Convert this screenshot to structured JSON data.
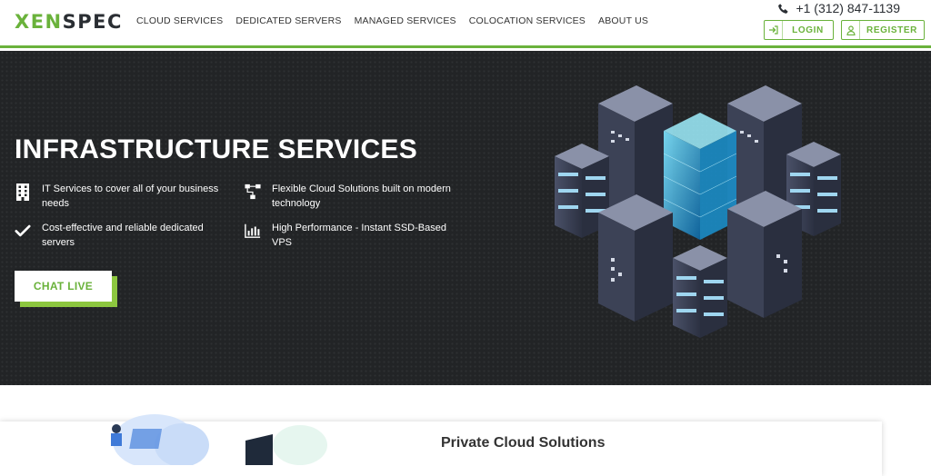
{
  "header": {
    "logo": {
      "part1": "XEN",
      "part2": "SPEC"
    },
    "nav": [
      "CLOUD SERVICES",
      "DEDICATED SERVERS",
      "MANAGED SERVICES",
      "COLOCATION SERVICES",
      "ABOUT US"
    ],
    "phone": "+1 (312) 847-1139",
    "login_label": "LOGIN",
    "register_label": "REGISTER"
  },
  "hero": {
    "title": "INFRASTRUCTURE SERVICES",
    "features": [
      {
        "icon": "building-icon",
        "text": "IT Services to cover all of your business needs"
      },
      {
        "icon": "network-icon",
        "text": "Flexible Cloud Solutions built on modern technology"
      },
      {
        "icon": "checkmark-icon",
        "text": "Cost-effective and reliable dedicated servers"
      },
      {
        "icon": "bar-chart-icon",
        "text": "High Performance - Instant SSD-Based VPS"
      }
    ],
    "cta_label": "CHAT LIVE"
  },
  "section": {
    "title": "Private Cloud Solutions"
  },
  "colors": {
    "accent": "#6ab23b",
    "hero_bg": "#222426",
    "cta_shadow": "#8cc63f"
  }
}
